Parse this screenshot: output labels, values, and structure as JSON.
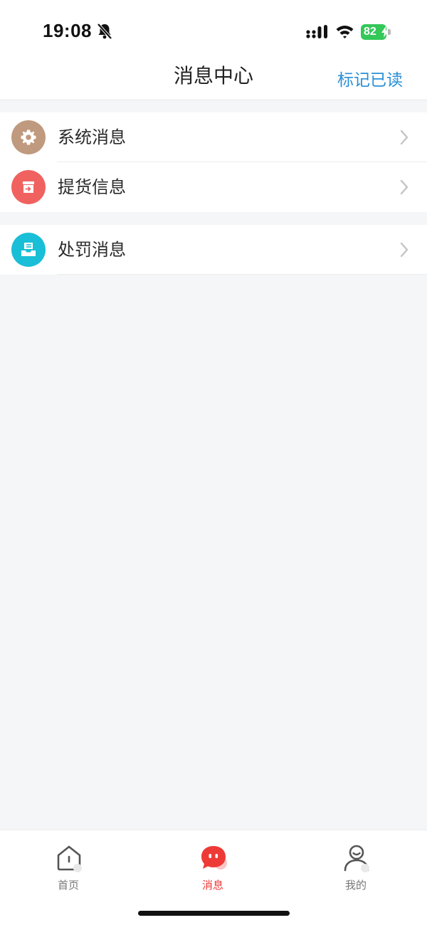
{
  "status_bar": {
    "time": "19:08",
    "battery_level": "82",
    "icons": [
      "bell-slash-icon",
      "cellular-signal-icon",
      "wifi-icon",
      "battery-charging-icon"
    ],
    "battery_color": "#34c759"
  },
  "nav": {
    "title": "消息中心",
    "action_label": "标记已读",
    "action_color": "#2a8fd6"
  },
  "groups": [
    {
      "items": [
        {
          "label": "系统消息",
          "icon": "gear-icon",
          "icon_bg": "#c09a7e"
        },
        {
          "label": "提货信息",
          "icon": "delivery-box-icon",
          "icon_bg": "#f0625f"
        }
      ]
    },
    {
      "items": [
        {
          "label": "处罚消息",
          "icon": "penalty-tray-icon",
          "icon_bg": "#19bfd6"
        }
      ]
    }
  ],
  "tab_bar": {
    "tabs": [
      {
        "label": "首页",
        "icon": "home-icon",
        "active": false
      },
      {
        "label": "消息",
        "icon": "chat-bubble-icon",
        "active": true
      },
      {
        "label": "我的",
        "icon": "user-icon",
        "active": false
      }
    ],
    "active_color": "#ee3a36",
    "inactive_color": "#777777"
  }
}
